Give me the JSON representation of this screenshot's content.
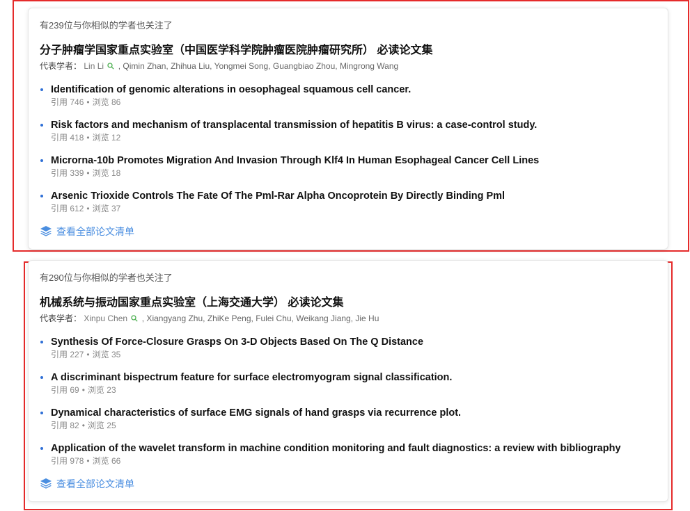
{
  "cards": [
    {
      "follow_text": "有239位与你相似的学者也关注了",
      "title": "分子肿瘤学国家重点实验室（中国医学科学院肿瘤医院肿瘤研究所） 必读论文集",
      "scholars_label": "代表学者：",
      "lead_scholar": "Lin Li",
      "other_scholars": ", Qimin Zhan, Zhihua Liu, Yongmei Song, Guangbiao Zhou, Mingrong Wang",
      "papers": [
        {
          "title": "Identification of genomic alterations in oesophageal squamous cell cancer.",
          "cite_label": "引用",
          "cites": "746",
          "view_label": "浏览",
          "views": "86"
        },
        {
          "title": "Risk factors and mechanism of transplacental transmission of hepatitis B virus: a case-control study.",
          "cite_label": "引用",
          "cites": "418",
          "view_label": "浏览",
          "views": "12"
        },
        {
          "title": "Microrna-10b Promotes Migration And Invasion Through Klf4 In Human Esophageal Cancer Cell Lines",
          "cite_label": "引用",
          "cites": "339",
          "view_label": "浏览",
          "views": "18"
        },
        {
          "title": "Arsenic Trioxide Controls The Fate Of The Pml-Rar Alpha Oncoprotein By Directly Binding Pml",
          "cite_label": "引用",
          "cites": "612",
          "view_label": "浏览",
          "views": "37"
        }
      ],
      "view_all": "查看全部论文清单"
    },
    {
      "follow_text": "有290位与你相似的学者也关注了",
      "title": "机械系统与振动国家重点实验室（上海交通大学） 必读论文集",
      "scholars_label": "代表学者：",
      "lead_scholar": "Xinpu Chen",
      "other_scholars": ", Xiangyang Zhu, ZhiKe Peng, Fulei Chu, Weikang Jiang, Jie Hu",
      "papers": [
        {
          "title": "Synthesis Of Force-Closure Grasps On 3-D Objects Based On The Q Distance",
          "cite_label": "引用",
          "cites": "227",
          "view_label": "浏览",
          "views": "35"
        },
        {
          "title": "A discriminant bispectrum feature for surface electromyogram signal classification.",
          "cite_label": "引用",
          "cites": "69",
          "view_label": "浏览",
          "views": "23"
        },
        {
          "title": "Dynamical characteristics of surface EMG signals of hand grasps via recurrence plot.",
          "cite_label": "引用",
          "cites": "82",
          "view_label": "浏览",
          "views": "25"
        },
        {
          "title": "Application of the wavelet transform in machine condition monitoring and fault diagnostics: a review with bibliography",
          "cite_label": "引用",
          "cites": "978",
          "view_label": "浏览",
          "views": "66"
        }
      ],
      "view_all": "查看全部论文清单"
    }
  ],
  "colors": {
    "highlight_border": "#e52b2b",
    "link": "#4a8ee0",
    "bullet": "#2f6fd6",
    "search_icon": "#4caf50"
  },
  "icons": {
    "search": "search-icon",
    "view_all": "layers-icon"
  }
}
